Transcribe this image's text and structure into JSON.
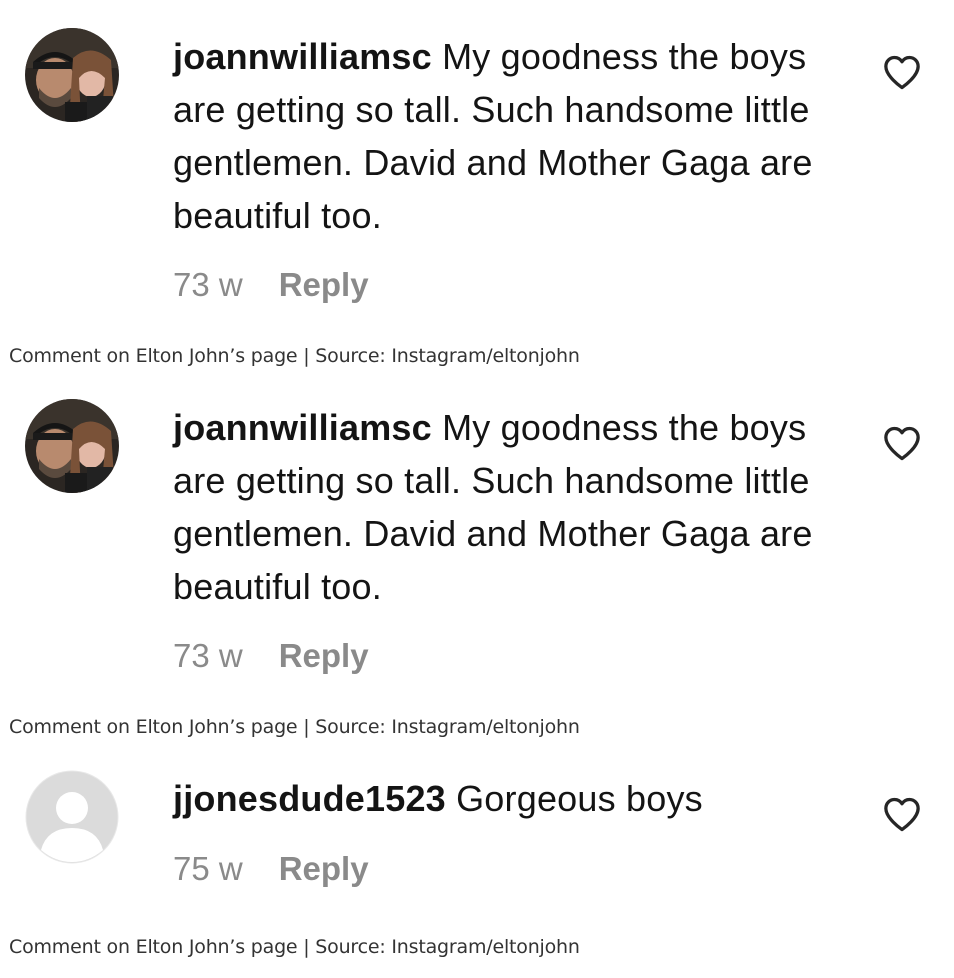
{
  "comments": [
    {
      "username": "joannwilliamsc",
      "text": " My goodness the boys are getting so tall. Such handsome little gentlemen. David and Mother Gaga are beautiful too.",
      "time": "73 w",
      "reply_label": "Reply",
      "avatar_icon": "profile-photo",
      "like_icon": "heart-icon",
      "caption": "Comment on Elton John’s page | Source: Instagram/eltonjohn"
    },
    {
      "username": "joannwilliamsc",
      "text": " My goodness the boys are getting so tall. Such handsome little gentlemen. David and Mother Gaga are beautiful too.",
      "time": "73 w",
      "reply_label": "Reply",
      "avatar_icon": "profile-photo",
      "like_icon": "heart-icon",
      "caption": "Comment on Elton John’s page | Source: Instagram/eltonjohn"
    },
    {
      "username": "jjonesdude1523",
      "text": " Gorgeous boys",
      "time": "75 w",
      "reply_label": "Reply",
      "avatar_icon": "default-avatar-icon",
      "like_icon": "heart-icon",
      "caption": "Comment on Elton John’s page | Source: Instagram/eltonjohn"
    }
  ],
  "colors": {
    "text": "#141414",
    "muted": "#8a8a8a",
    "caption": "#333333",
    "placeholder_avatar": "#dbdbdb"
  }
}
